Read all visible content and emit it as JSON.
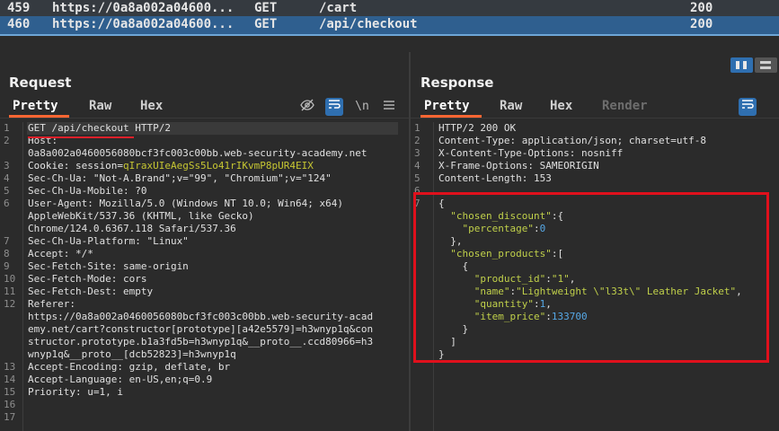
{
  "history": [
    {
      "num": "459",
      "host": "https://0a8a002a04600...",
      "method": "GET",
      "url": "/cart",
      "status": "200"
    },
    {
      "num": "460",
      "host": "https://0a8a002a04600...",
      "method": "GET",
      "url": "/api/checkout",
      "status": "200"
    }
  ],
  "request": {
    "title": "Request",
    "tabs": [
      "Pretty",
      "Raw",
      "Hex"
    ],
    "active_tab": "Pretty",
    "icons": [
      "eye-off-icon",
      "wrap-icon",
      "newline-icon",
      "menu-icon"
    ],
    "newline_label": "\\n",
    "lines": [
      {
        "n": "1",
        "text": "GET /api/checkout HTTP/2"
      },
      {
        "n": "2",
        "text": "Host:"
      },
      {
        "n": "",
        "text": "0a8a002a0460056080bcf3fc003c00bb.web-security-academy.net"
      },
      {
        "n": "3",
        "k": "Cookie: session=",
        "cookie": "qIraxUIeAegSs5Lo41rIKvmP8pUR4EIX"
      },
      {
        "n": "4",
        "text": "Sec-Ch-Ua: \"Not-A.Brand\";v=\"99\", \"Chromium\";v=\"124\""
      },
      {
        "n": "5",
        "text": "Sec-Ch-Ua-Mobile: ?0"
      },
      {
        "n": "6",
        "text": "User-Agent: Mozilla/5.0 (Windows NT 10.0; Win64; x64)"
      },
      {
        "n": "",
        "text": "AppleWebKit/537.36 (KHTML, like Gecko)"
      },
      {
        "n": "",
        "text": "Chrome/124.0.6367.118 Safari/537.36"
      },
      {
        "n": "7",
        "text": "Sec-Ch-Ua-Platform: \"Linux\""
      },
      {
        "n": "8",
        "text": "Accept: */*"
      },
      {
        "n": "9",
        "text": "Sec-Fetch-Site: same-origin"
      },
      {
        "n": "10",
        "text": "Sec-Fetch-Mode: cors"
      },
      {
        "n": "11",
        "text": "Sec-Fetch-Dest: empty"
      },
      {
        "n": "12",
        "text": "Referer:"
      },
      {
        "n": "",
        "text": "https://0a8a002a0460056080bcf3fc003c00bb.web-security-acad"
      },
      {
        "n": "",
        "text": "emy.net/cart?constructor[prototype][a42e5579]=h3wnyp1q&con"
      },
      {
        "n": "",
        "text": "structor.prototype.b1a3fd5b=h3wnyp1q&__proto__.ccd80966=h3"
      },
      {
        "n": "",
        "text": "wnyp1q&__proto__[dcb52823]=h3wnyp1q"
      },
      {
        "n": "13",
        "text": "Accept-Encoding: gzip, deflate, br"
      },
      {
        "n": "14",
        "text": "Accept-Language: en-US,en;q=0.9"
      },
      {
        "n": "15",
        "text": "Priority: u=1, i"
      },
      {
        "n": "16",
        "text": ""
      },
      {
        "n": "17",
        "text": ""
      }
    ]
  },
  "response": {
    "title": "Response",
    "tabs": [
      "Pretty",
      "Raw",
      "Hex",
      "Render"
    ],
    "active_tab": "Pretty",
    "lines": [
      {
        "n": "1",
        "text": "HTTP/2 200 OK"
      },
      {
        "n": "2",
        "text": "Content-Type: application/json; charset=utf-8"
      },
      {
        "n": "3",
        "text": "X-Content-Type-Options: nosniff"
      },
      {
        "n": "4",
        "text": "X-Frame-Options: SAMEORIGIN"
      },
      {
        "n": "5",
        "text": "Content-Length: 153"
      },
      {
        "n": "6",
        "text": ""
      },
      {
        "n": "7",
        "parts": [
          [
            "jp",
            "{"
          ]
        ]
      },
      {
        "n": "",
        "parts": [
          [
            "jp",
            "  "
          ],
          [
            "jkey",
            "\"chosen_discount\""
          ],
          [
            "jp",
            ":{"
          ]
        ]
      },
      {
        "n": "",
        "parts": [
          [
            "jp",
            "    "
          ],
          [
            "jkey",
            "\"percentage\""
          ],
          [
            "jp",
            ":"
          ],
          [
            "jnum",
            "0"
          ]
        ]
      },
      {
        "n": "",
        "parts": [
          [
            "jp",
            "  },"
          ]
        ]
      },
      {
        "n": "",
        "parts": [
          [
            "jp",
            "  "
          ],
          [
            "jkey",
            "\"chosen_products\""
          ],
          [
            "jp",
            ":["
          ]
        ]
      },
      {
        "n": "",
        "parts": [
          [
            "jp",
            "    {"
          ]
        ]
      },
      {
        "n": "",
        "parts": [
          [
            "jp",
            "      "
          ],
          [
            "jkey",
            "\"product_id\""
          ],
          [
            "jp",
            ":"
          ],
          [
            "jstr",
            "\"1\""
          ],
          [
            "jp",
            ","
          ]
        ]
      },
      {
        "n": "",
        "parts": [
          [
            "jp",
            "      "
          ],
          [
            "jkey",
            "\"name\""
          ],
          [
            "jp",
            ":"
          ],
          [
            "jstr",
            "\"Lightweight \\\"l33t\\\" Leather Jacket\""
          ],
          [
            "jp",
            ","
          ]
        ]
      },
      {
        "n": "",
        "parts": [
          [
            "jp",
            "      "
          ],
          [
            "jkey",
            "\"quantity\""
          ],
          [
            "jp",
            ":"
          ],
          [
            "jnum",
            "1"
          ],
          [
            "jp",
            ","
          ]
        ]
      },
      {
        "n": "",
        "parts": [
          [
            "jp",
            "      "
          ],
          [
            "jkey",
            "\"item_price\""
          ],
          [
            "jp",
            ":"
          ],
          [
            "jnum",
            "133700"
          ]
        ]
      },
      {
        "n": "",
        "parts": [
          [
            "jp",
            "    }"
          ]
        ]
      },
      {
        "n": "",
        "parts": [
          [
            "jp",
            "  ]"
          ]
        ]
      },
      {
        "n": "",
        "parts": [
          [
            "jp",
            "}"
          ]
        ]
      }
    ]
  },
  "colors": {
    "accent_tab": "#ff6633",
    "selected_row": "#2f5f8f",
    "annotation": "#e0101c"
  }
}
